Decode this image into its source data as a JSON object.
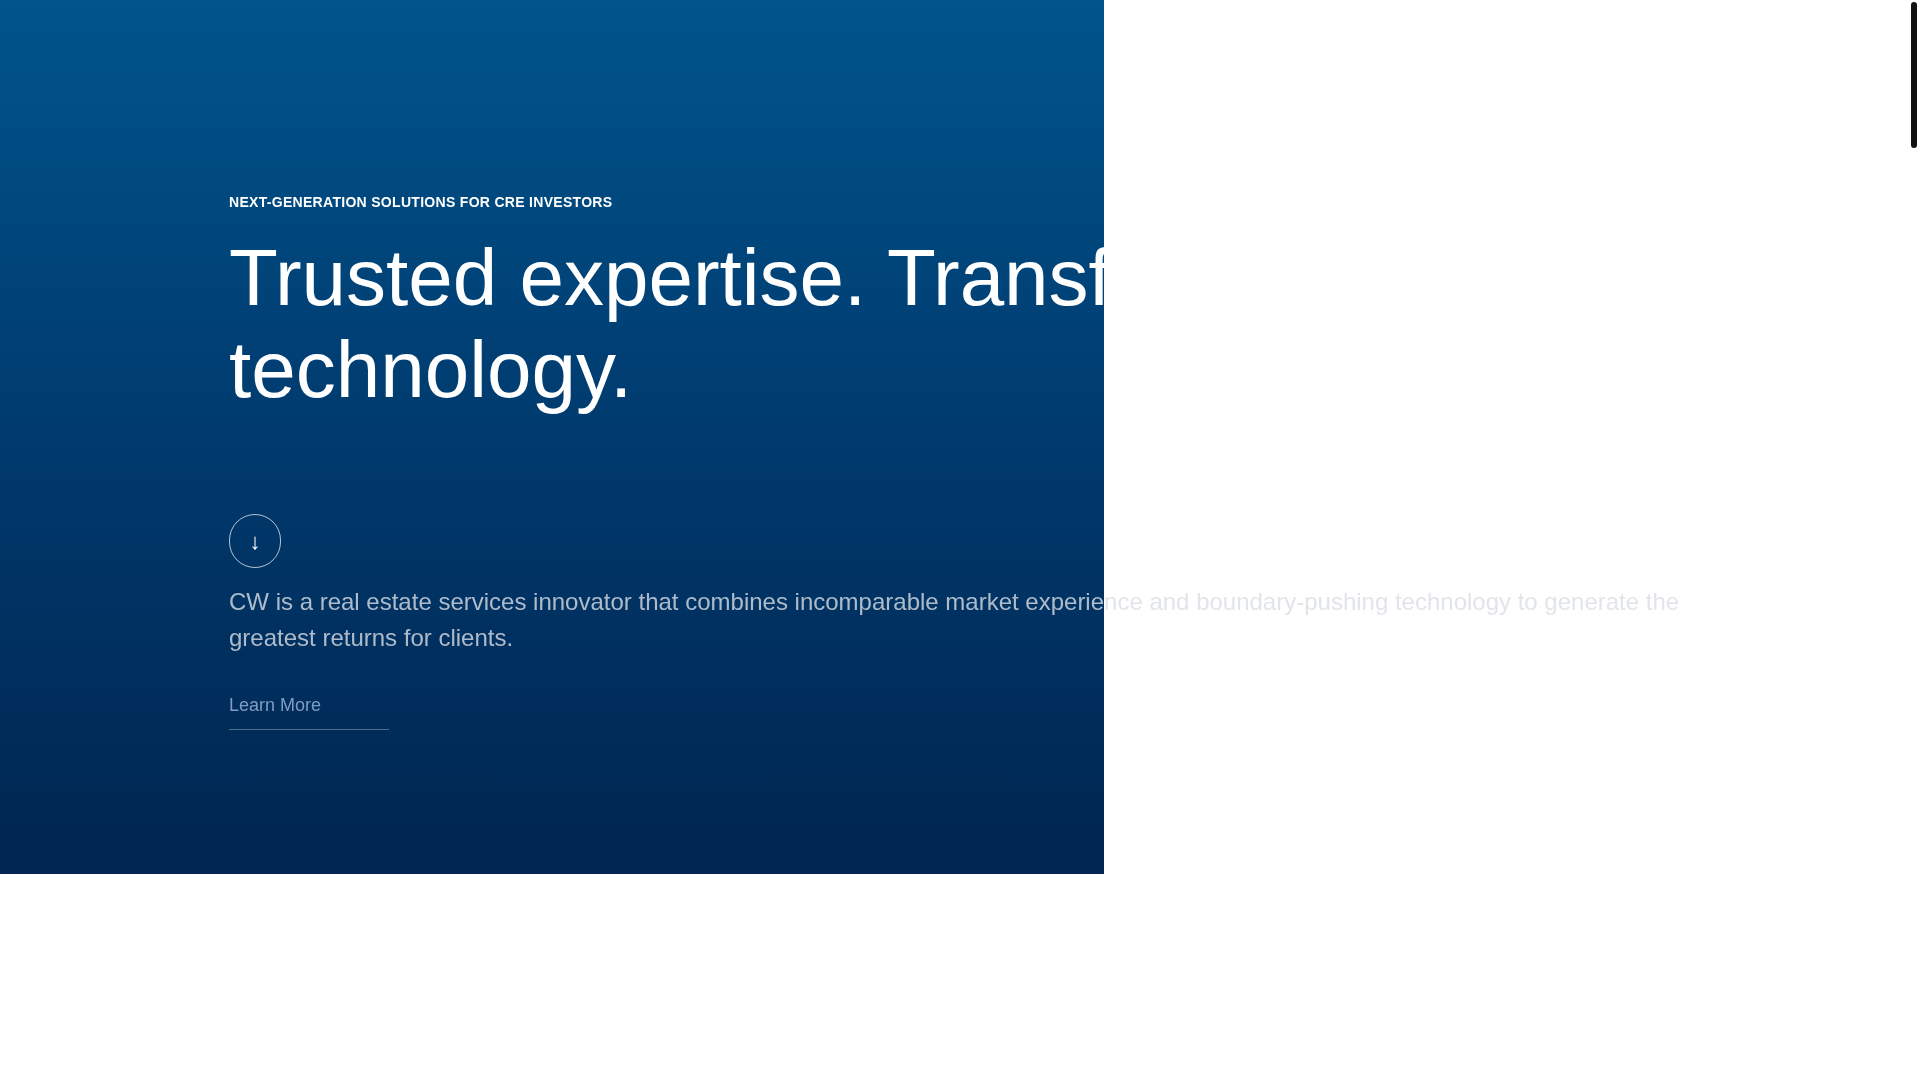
{
  "hero": {
    "eyebrow": "NEXT-GENERATION SOLUTIONS FOR CRE INVESTORS",
    "heading_lines": [
      "Trusted expertise. Transf",
      "technology."
    ],
    "scroll_button": {
      "icon": "↓"
    },
    "description": "CW is a real estate services innovator that combines incomparable market experience and boundary-pushing technology to generate the greatest returns for clients.",
    "link": "Learn More"
  }
}
